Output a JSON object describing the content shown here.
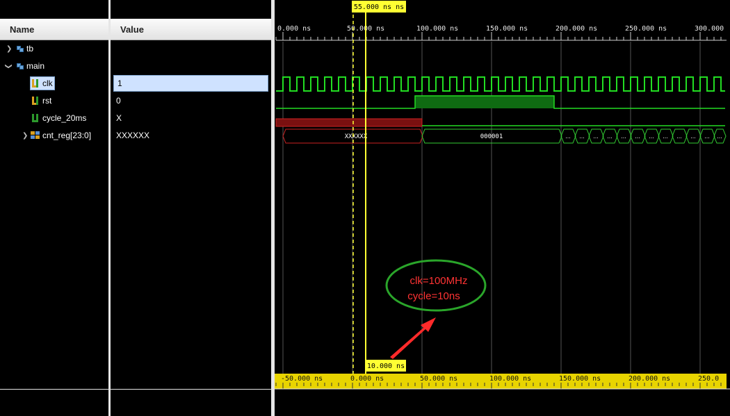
{
  "columns": {
    "name": "Name",
    "value": "Value"
  },
  "signals": [
    {
      "name": "tb",
      "value": "",
      "kind": "scope",
      "expand": "collapsed",
      "icon": "scope-icon"
    },
    {
      "name": "main",
      "value": "",
      "kind": "scope",
      "expand": "expanded",
      "icon": "scope-icon"
    },
    {
      "name": "clk",
      "value": "1",
      "kind": "signal",
      "icon": "logic-signal-icon",
      "selected": true
    },
    {
      "name": "rst",
      "value": "0",
      "kind": "signal",
      "icon": "logic-signal-icon"
    },
    {
      "name": "cycle_20ms",
      "value": "X",
      "kind": "signal",
      "icon": "logic-signal-icon"
    },
    {
      "name": "cnt_reg[23:0]",
      "value": "XXXXXX",
      "kind": "bus",
      "expand": "collapsed",
      "icon": "bus-icon"
    }
  ],
  "timeline": {
    "cursor_label": "55.000 ns  ns",
    "top_ticks": [
      "0.000 ns",
      "50.000 ns",
      "100.000 ns",
      "150.000 ns",
      "200.000 ns",
      "250.000 ns",
      "300.000"
    ],
    "delta_label": "10.000 ns",
    "bottom_ticks": [
      "-50.000 ns",
      "0.000 ns",
      "50.000 ns",
      "100.000 ns",
      "150.000 ns",
      "200.000 ns",
      "250.0"
    ]
  },
  "waveforms": {
    "clk_period_ns": 10,
    "rst_high_from_ns": 95,
    "rst_high_to_ns": 195,
    "cycle_x_until_ns": 100,
    "cnt_segments": [
      {
        "from_ns": 0,
        "to_ns": 100,
        "label": "XXXXXX",
        "undefined": true
      },
      {
        "from_ns": 100,
        "to_ns": 200,
        "label": "000001",
        "undefined": false
      }
    ],
    "cnt_fast_label": "...",
    "cnt_fast_period_ns": 10
  },
  "annotation": {
    "line1": "clk=100MHz",
    "line2": "cycle=10ns"
  },
  "colors": {
    "wave_green": "#22dd22",
    "bus_green": "#33cc33",
    "undefined_red": "#cc2222",
    "cursor_yellow": "#ffff33",
    "ruler_yellow": "#e8d400",
    "annotation_red": "#ff3333",
    "annotation_green": "#2aa52a"
  }
}
